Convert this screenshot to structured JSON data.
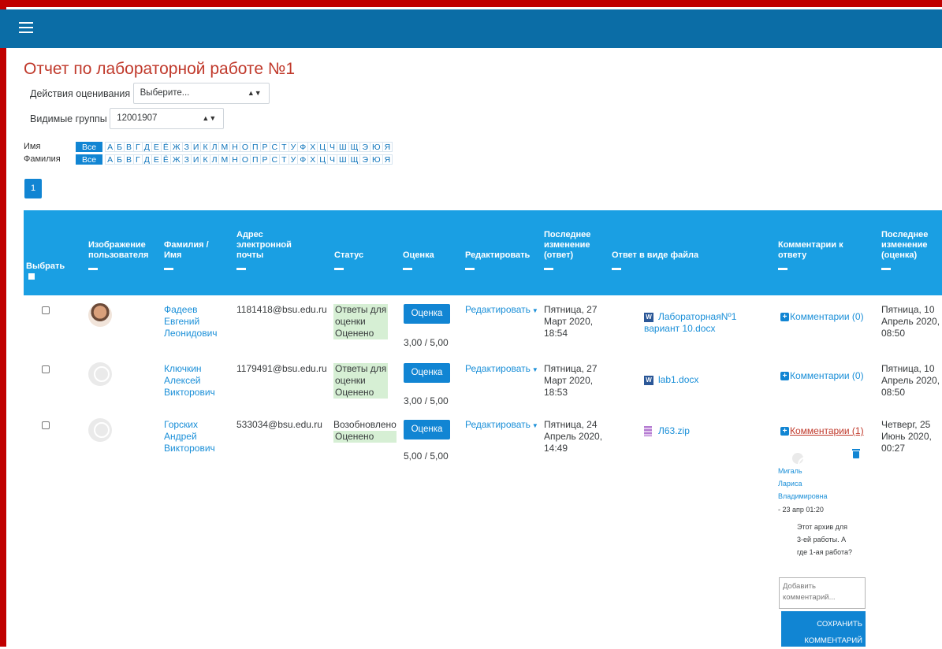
{
  "page": {
    "title": "Отчет по лабораторной работе №1"
  },
  "grading_actions": {
    "label": "Действия оценивания",
    "value": "Выберите..."
  },
  "visible_groups": {
    "label": "Видимые группы",
    "value": "12001907"
  },
  "filters": {
    "first_name_label": "Имя",
    "last_name_label": "Фамилия",
    "all_label": "Все",
    "letters": [
      "А",
      "Б",
      "В",
      "Г",
      "Д",
      "Е",
      "Ё",
      "Ж",
      "З",
      "И",
      "К",
      "Л",
      "М",
      "Н",
      "О",
      "П",
      "Р",
      "С",
      "Т",
      "У",
      "Ф",
      "Х",
      "Ц",
      "Ч",
      "Ш",
      "Щ",
      "Э",
      "Ю",
      "Я"
    ]
  },
  "pagination": {
    "current": "1"
  },
  "table": {
    "headers": {
      "select": "Выбрать",
      "user_picture": "Изображение пользователя",
      "name": "Фамилия / Имя",
      "email": "Адрес электронной почты",
      "status": "Статус",
      "grade": "Оценка",
      "edit": "Редактировать",
      "last_modified_submission": "Последнее изменение (ответ)",
      "file_submission": "Ответ в виде файла",
      "submission_comments": "Комментарии к ответу",
      "last_modified_grade": "Последнее изменение (оценка)"
    },
    "grade_button": "Оценка",
    "edit_label": "Редактировать",
    "rows": [
      {
        "name_line1": "Фадеев",
        "name_line2": "Евгений",
        "name_line3": "Леонидович",
        "email": "1181418@bsu.edu.ru",
        "status_line1": "Ответы для",
        "status_line2": "оценки",
        "status_line3": "Оценено",
        "grade": "3,00 / 5,00",
        "sub_date_1": "Пятница, 27",
        "sub_date_2": "Март 2020,",
        "sub_date_3": "18:54",
        "file_line1": "ЛабораторнаяNº1",
        "file_line2": "вариант 10.docx",
        "comments": "Комментарии (0)",
        "grade_date_1": "Пятница, 10",
        "grade_date_2": "Апрель 2020,",
        "grade_date_3": "08:50"
      },
      {
        "name_line1": "Ключкин",
        "name_line2": "Алексей",
        "name_line3": "Викторович",
        "email": "1179491@bsu.edu.ru",
        "status_line1": "Ответы для",
        "status_line2": "оценки",
        "status_line3": "Оценено",
        "grade": "3,00 / 5,00",
        "sub_date_1": "Пятница, 27",
        "sub_date_2": "Март 2020,",
        "sub_date_3": "18:53",
        "file_line1": "lab1.docx",
        "comments": "Комментарии (0)",
        "grade_date_1": "Пятница, 10",
        "grade_date_2": "Апрель 2020,",
        "grade_date_3": "08:50"
      },
      {
        "name_line1": "Горских",
        "name_line2": "Андрей",
        "name_line3": "Викторович",
        "email": "533034@bsu.edu.ru",
        "status_line1": "Возобновлено",
        "status_line2": "Оценено",
        "grade": "5,00 / 5,00",
        "sub_date_1": "Пятница, 24",
        "sub_date_2": "Апрель 2020,",
        "sub_date_3": "14:49",
        "file_line1": "Л63.zip",
        "comments": "Комментарии (1)",
        "grade_date_1": "Четверг, 25",
        "grade_date_2": "Июнь 2020,",
        "grade_date_3": "00:27"
      }
    ],
    "comment": {
      "author_1": "Мигаль",
      "author_2": "Лариса",
      "author_3": "Владимировна",
      "date": "- 23 апр 01:20",
      "text_1": "Этот архив для",
      "text_2": "3-ей работы. А",
      "text_3": "где 1-ая работа?",
      "placeholder_1": "Добавить",
      "placeholder_2": "комментарий...",
      "save_1": "СОХРАНИТЬ",
      "save_2": "КОММЕНТАРИЙ"
    }
  },
  "colors": {
    "topbar": "#0b6da6",
    "table_header": "#1a9fe3",
    "button": "#1185d3",
    "title": "#c0392b",
    "frame": "#c00000"
  }
}
